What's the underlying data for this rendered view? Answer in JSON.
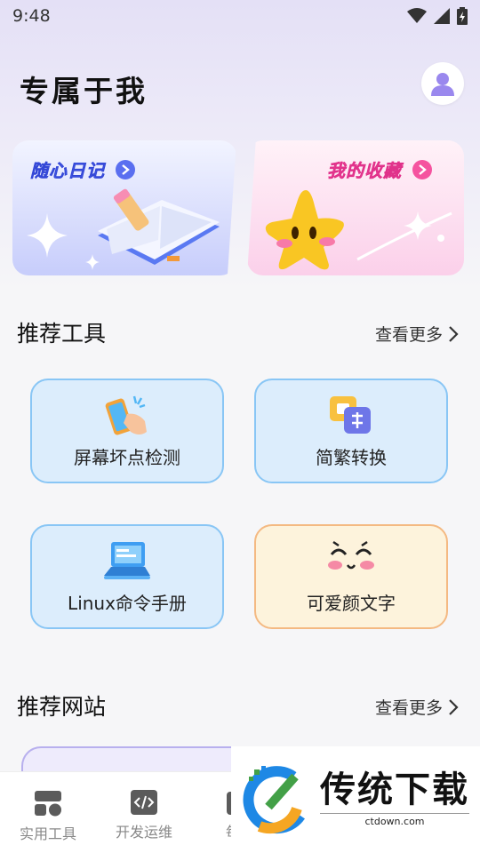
{
  "status_bar": {
    "time": "9:48"
  },
  "header": {
    "title": "专属于我"
  },
  "cards": {
    "diary": {
      "label": "随心日记"
    },
    "favorites": {
      "label": "我的收藏"
    }
  },
  "tools_section": {
    "title": "推荐工具",
    "more": "查看更多",
    "items": [
      {
        "label": "屏幕坏点检测",
        "icon": "hand-phone-icon"
      },
      {
        "label": "简繁转换",
        "icon": "translate-icon"
      },
      {
        "label": "Linux命令手册",
        "icon": "laptop-icon"
      },
      {
        "label": "可爱颜文字",
        "icon": "cute-face-icon"
      }
    ]
  },
  "sites_section": {
    "title": "推荐网站",
    "more": "查看更多"
  },
  "bottom_nav": {
    "items": [
      {
        "label": "实用工具"
      },
      {
        "label": "开发运维"
      },
      {
        "label": "每日"
      }
    ]
  },
  "watermark": {
    "text": "传统下载",
    "url": "ctdown.com"
  },
  "colors": {
    "accent_blue": "#4f66f0",
    "accent_pink": "#f5499f",
    "tool_border": "#89c6f5"
  }
}
